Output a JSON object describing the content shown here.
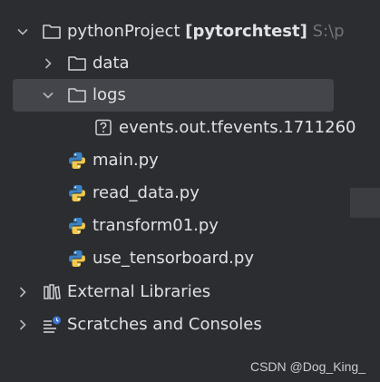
{
  "tree": {
    "project": {
      "name": "pythonProject",
      "context": "[pytorchtest]",
      "path": "S:\\p"
    },
    "data_folder": "data",
    "logs_folder": "logs",
    "event_file": "events.out.tfevents.1711260",
    "files": [
      "main.py",
      "read_data.py",
      "transform01.py",
      "use_tensorboard.py"
    ],
    "external_libraries": "External Libraries",
    "scratches": "Scratches and Consoles"
  },
  "watermark": "CSDN @Dog_King_",
  "colors": {
    "background": "#2b2d30",
    "selection": "#43454a",
    "text": "#dfe1e5",
    "dim": "#6f737a"
  }
}
